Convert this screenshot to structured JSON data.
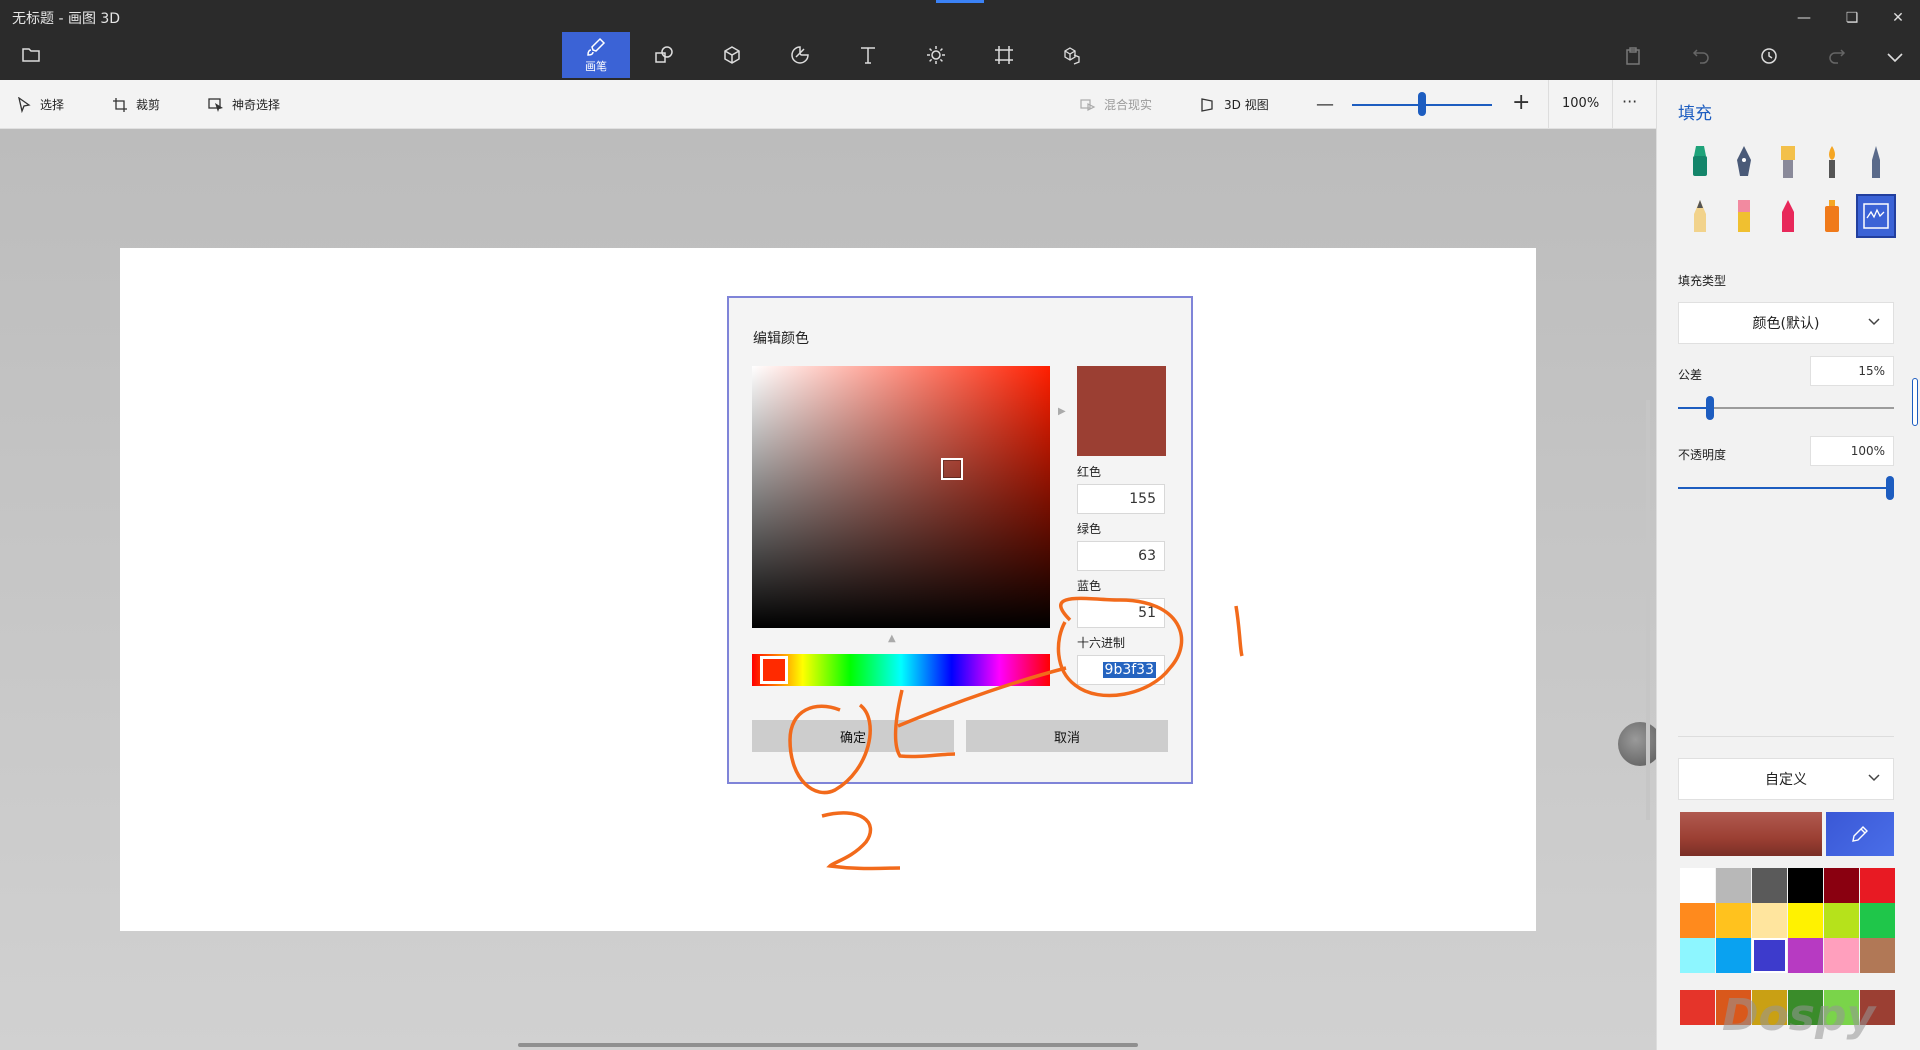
{
  "window": {
    "title": "无标题 - 画图 3D"
  },
  "toolbar": {
    "tools": [
      {
        "id": "brushes",
        "label": "画笔",
        "icon": "brush-icon",
        "active": true
      },
      {
        "id": "2d-shapes",
        "label": "",
        "icon": "2d-shapes-icon"
      },
      {
        "id": "3d-shapes",
        "label": "",
        "icon": "3d-cube-icon"
      },
      {
        "id": "stickers",
        "label": "",
        "icon": "sticker-icon"
      },
      {
        "id": "text",
        "label": "",
        "icon": "text-icon"
      },
      {
        "id": "effects",
        "label": "",
        "icon": "effects-sun-icon"
      },
      {
        "id": "canvas",
        "label": "",
        "icon": "canvas-crop-icon"
      },
      {
        "id": "3d-library",
        "label": "",
        "icon": "3d-library-icon"
      }
    ]
  },
  "subbar": {
    "select_label": "选择",
    "crop_label": "裁剪",
    "magic_select_label": "神奇选择",
    "mixed_reality_label": "混合现实",
    "view3d_label": "3D 视图",
    "zoom_value": "100%",
    "zoom_fraction": 0.5,
    "more_label": "···"
  },
  "dialog": {
    "title": "编辑颜色",
    "color_hex": "#9b3f33",
    "red_label": "红色",
    "red_value": "155",
    "green_label": "绿色",
    "green_value": "63",
    "blue_label": "蓝色",
    "blue_value": "51",
    "hex_label": "十六进制",
    "hex_value": "9b3f33",
    "ok_label": "确定",
    "cancel_label": "取消"
  },
  "panel": {
    "title": "填充",
    "fill_type_label": "填充类型",
    "fill_type_value": "颜色(默认)",
    "tolerance_label": "公差",
    "tolerance_value": "15%",
    "tolerance_fraction": 0.15,
    "opacity_label": "不透明度",
    "opacity_value": "100%",
    "opacity_fraction": 1.0,
    "palette_dropdown": "自定义",
    "current_color": "#9b3f33",
    "palette": [
      "#ffffff",
      "#b8b8b8",
      "#5a5a5a",
      "#000000",
      "#8a0010",
      "#e81a23",
      "#ff8a1d",
      "#ffc21e",
      "#ffe59e",
      "#fff200",
      "#b6e21b",
      "#1fc64a",
      "#8df6ff",
      "#0aa2f0",
      "#3d3bcc",
      "#b73ac2",
      "#ff9fbd",
      "#b17856"
    ],
    "bottom_row": [
      "#e5342a",
      "#d9581b",
      "#c9a014",
      "#3a8c2a",
      "#7ad44a",
      "#9b3f33"
    ]
  },
  "annotations": {
    "marker_1": "1",
    "marker_2": "2"
  },
  "watermark": "Dospy"
}
